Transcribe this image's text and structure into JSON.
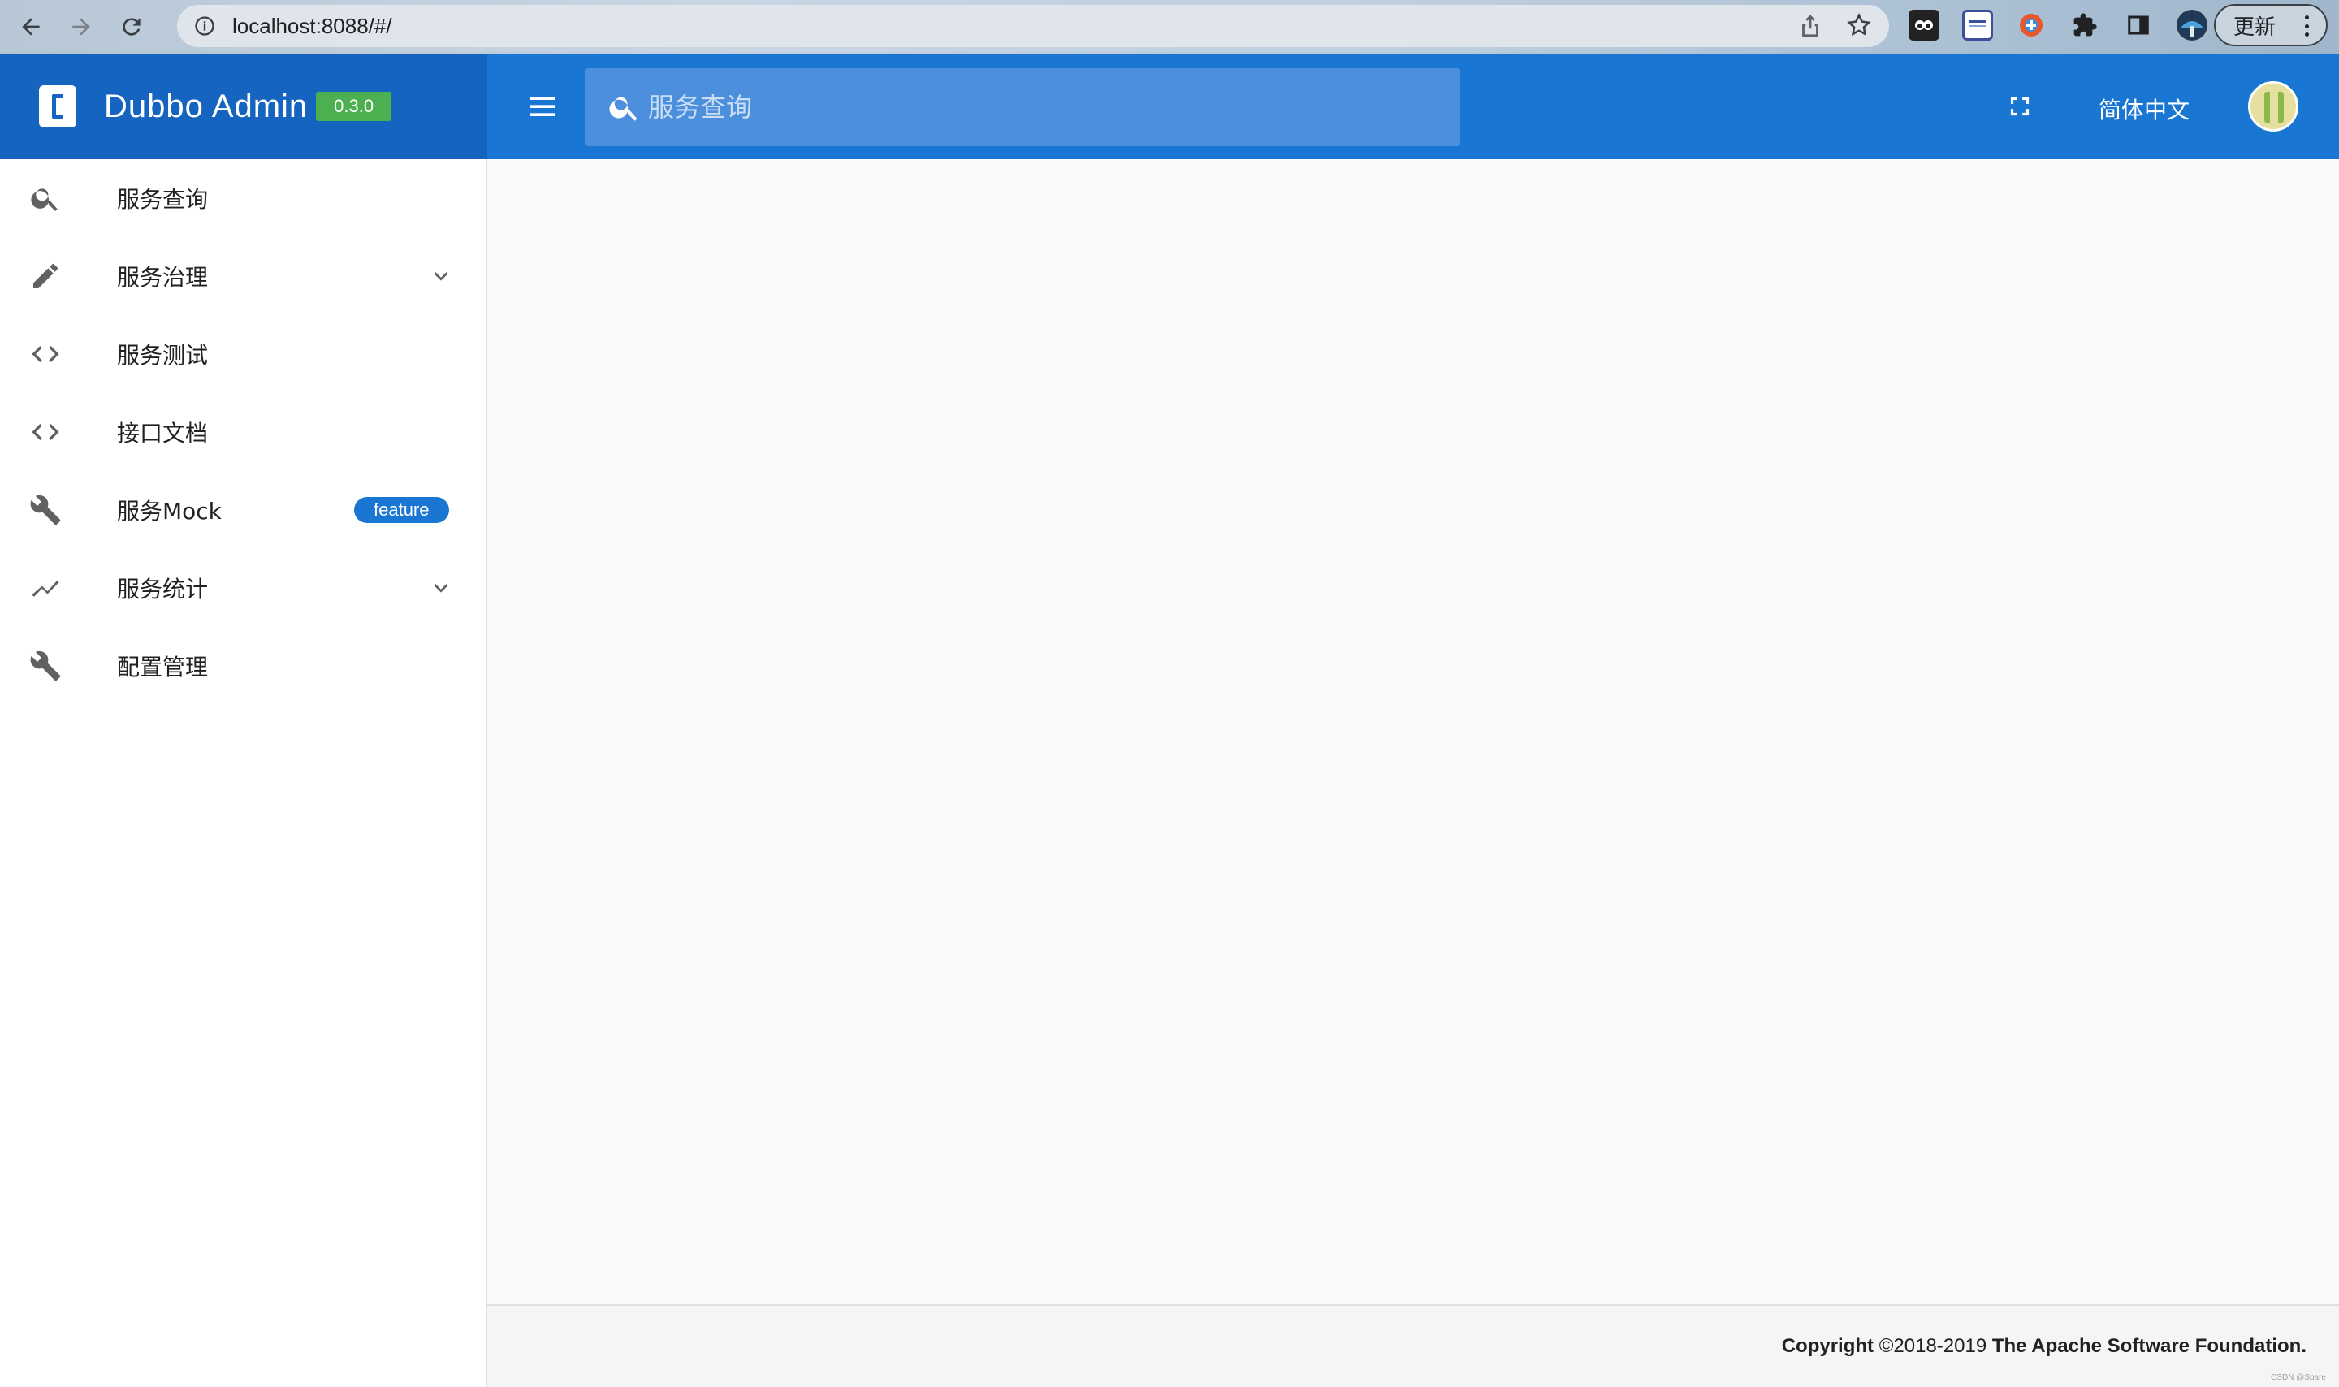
{
  "browser": {
    "url": "localhost:8088/#/",
    "update_label": "更新"
  },
  "header": {
    "brand_name": "Dubbo Admin",
    "version": "0.3.0",
    "search_placeholder": "服务查询",
    "language": "简体中文",
    "color": "#1976d2",
    "brand_color": "#1565c0"
  },
  "sidebar": {
    "items": [
      {
        "label": "服务查询",
        "icon": "search-icon"
      },
      {
        "label": "服务治理",
        "icon": "pencil-icon",
        "expandable": true
      },
      {
        "label": "服务测试",
        "icon": "code-icon"
      },
      {
        "label": "接口文档",
        "icon": "code-icon"
      },
      {
        "label": "服务Mock",
        "icon": "wrench-icon",
        "badge": "feature"
      },
      {
        "label": "服务统计",
        "icon": "trending-up-icon",
        "expandable": true
      },
      {
        "label": "配置管理",
        "icon": "wrench-icon"
      }
    ]
  },
  "footer": {
    "copyright_prefix": "Copyright",
    "years": "©2018-2019",
    "org": "The Apache Software Foundation.",
    "watermark": "CSDN @Spare"
  }
}
